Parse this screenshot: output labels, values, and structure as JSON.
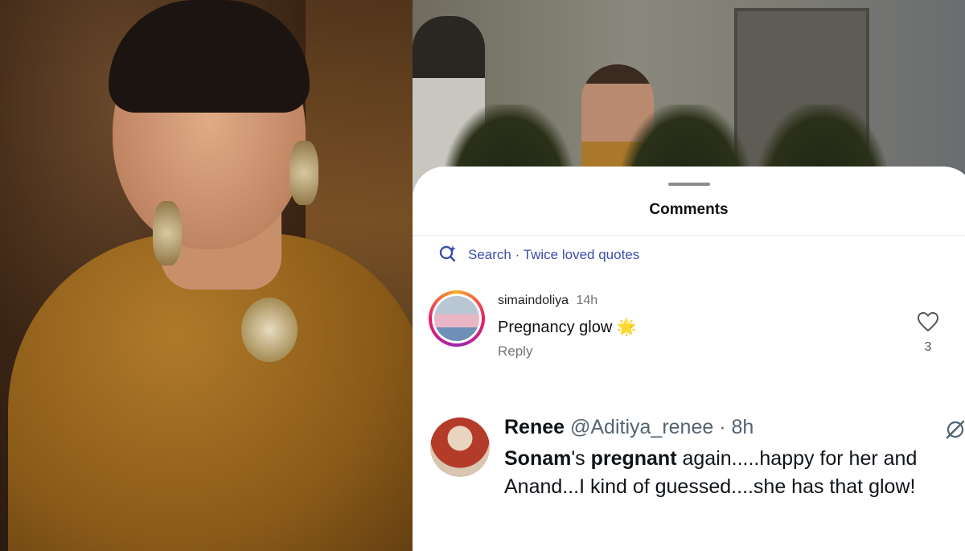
{
  "sheet": {
    "title": "Comments",
    "search_label": "Search · Twice loved quotes"
  },
  "comment1": {
    "username": "simaindoliya",
    "time": "14h",
    "text": "Pregnancy glow",
    "emoji": "🌟",
    "reply_label": "Reply",
    "like_count": "3"
  },
  "comment2": {
    "name": "Renee",
    "handle": "@Aditiya_renee",
    "time": "· 8h",
    "text_parts": [
      "Sonam",
      "'s ",
      "pregnant",
      " again.....happy for her and Anand...I kind of guessed....she has that glow!"
    ]
  },
  "colors": {
    "accent_link": "#3b4ea8",
    "muted": "#737373"
  },
  "icons": [
    "search-sparkle-icon",
    "heart-icon",
    "grok-icon"
  ]
}
